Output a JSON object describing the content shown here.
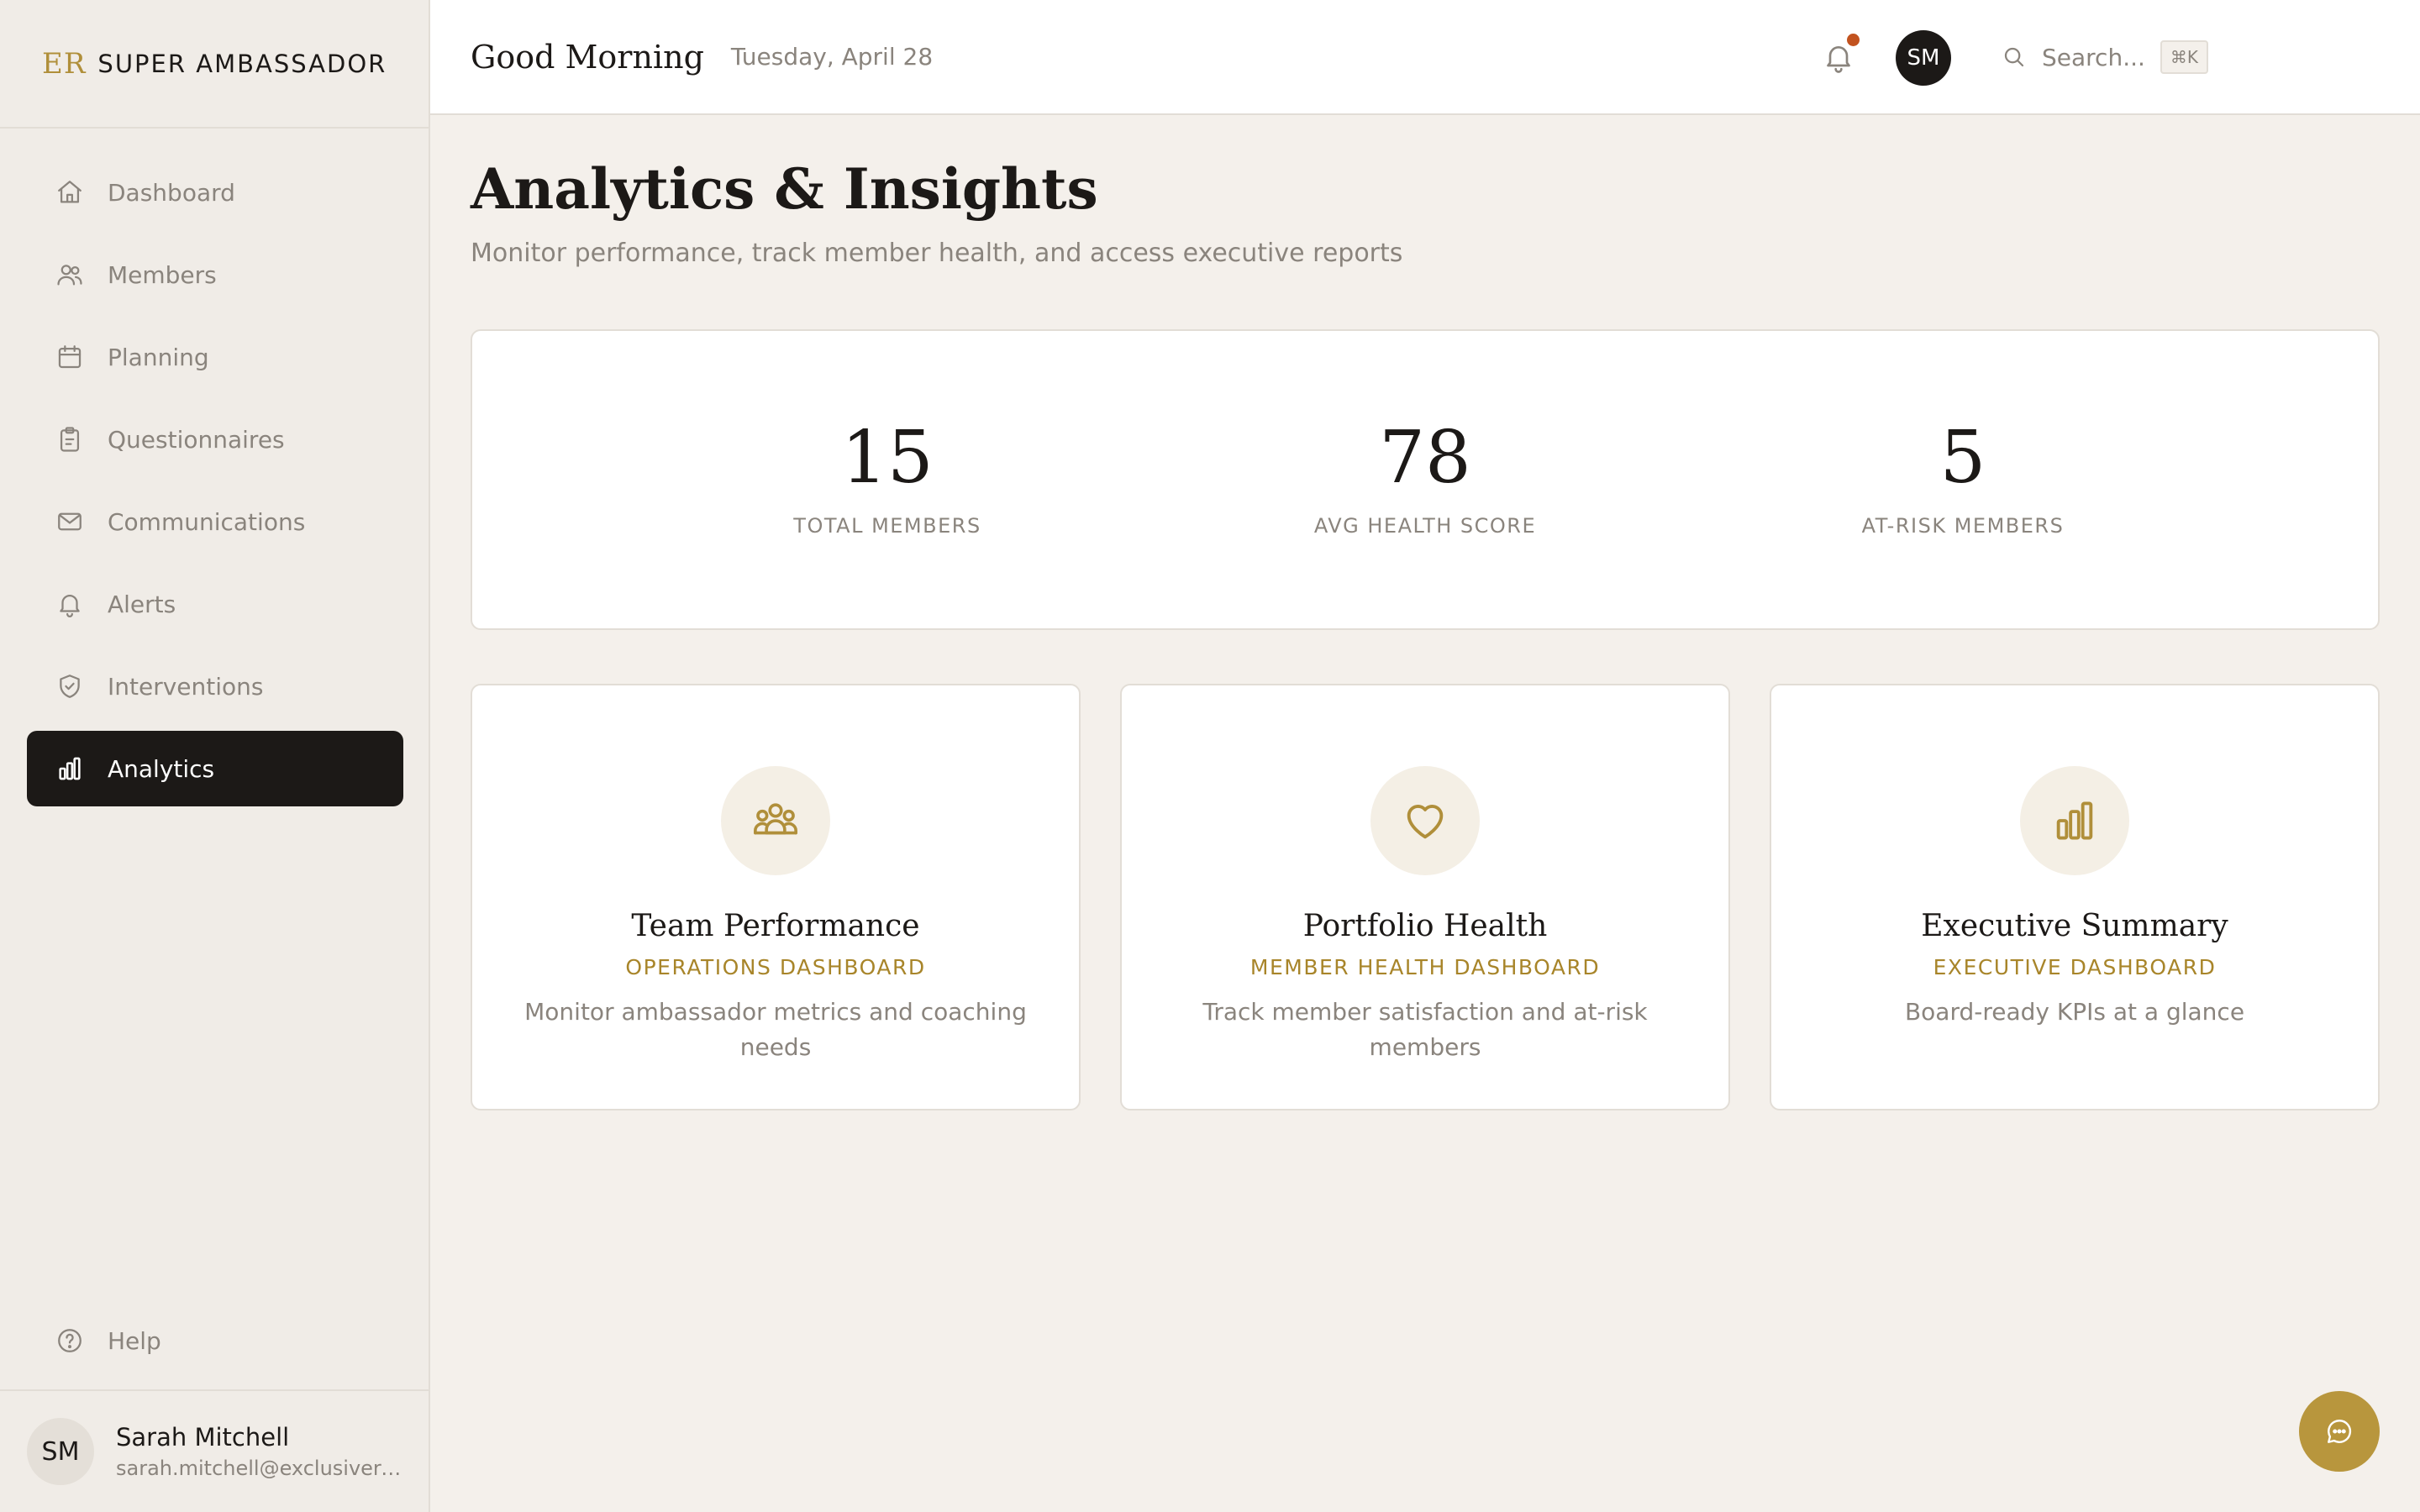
{
  "brand": {
    "mark": "ER",
    "name": "SUPER AMBASSADOR"
  },
  "sidebar": {
    "items": [
      {
        "label": "Dashboard",
        "icon": "home-icon"
      },
      {
        "label": "Members",
        "icon": "users-icon"
      },
      {
        "label": "Planning",
        "icon": "calendar-icon"
      },
      {
        "label": "Questionnaires",
        "icon": "clipboard-icon"
      },
      {
        "label": "Communications",
        "icon": "mail-icon"
      },
      {
        "label": "Alerts",
        "icon": "bell-icon"
      },
      {
        "label": "Interventions",
        "icon": "shield-check-icon"
      },
      {
        "label": "Analytics",
        "icon": "bar-chart-icon",
        "active": true
      }
    ],
    "help_label": "Help",
    "user": {
      "initials": "SM",
      "name": "Sarah Mitchell",
      "email": "sarah.mitchell@exclusiveresorts.com"
    }
  },
  "header": {
    "greeting": "Good Morning",
    "date": "Tuesday, April 28",
    "search_placeholder": "Search...",
    "shortcut": "⌘K",
    "avatar_initials": "SM",
    "notification_dot_color": "#c2531f"
  },
  "main": {
    "title": "Analytics & Insights",
    "subtitle": "Monitor performance, track member health, and access executive reports",
    "stats": [
      {
        "value": "15",
        "label": "TOTAL MEMBERS"
      },
      {
        "value": "78",
        "label": "AVG HEALTH SCORE"
      },
      {
        "value": "5",
        "label": "AT-RISK MEMBERS"
      }
    ],
    "cards": [
      {
        "icon": "team-icon",
        "title": "Team Performance",
        "kicker": "OPERATIONS DASHBOARD",
        "description": "Monitor ambassador metrics and coaching needs"
      },
      {
        "icon": "heart-icon",
        "title": "Portfolio Health",
        "kicker": "MEMBER HEALTH DASHBOARD",
        "description": "Track member satisfaction and at-risk members"
      },
      {
        "icon": "bar-chart-icon",
        "title": "Executive Summary",
        "kicker": "EXECUTIVE DASHBOARD",
        "description": "Board-ready KPIs at a glance"
      }
    ]
  },
  "colors": {
    "accent_gold": "#b8963d",
    "active_nav": "#1c1917",
    "background": "#f4f0eb"
  }
}
